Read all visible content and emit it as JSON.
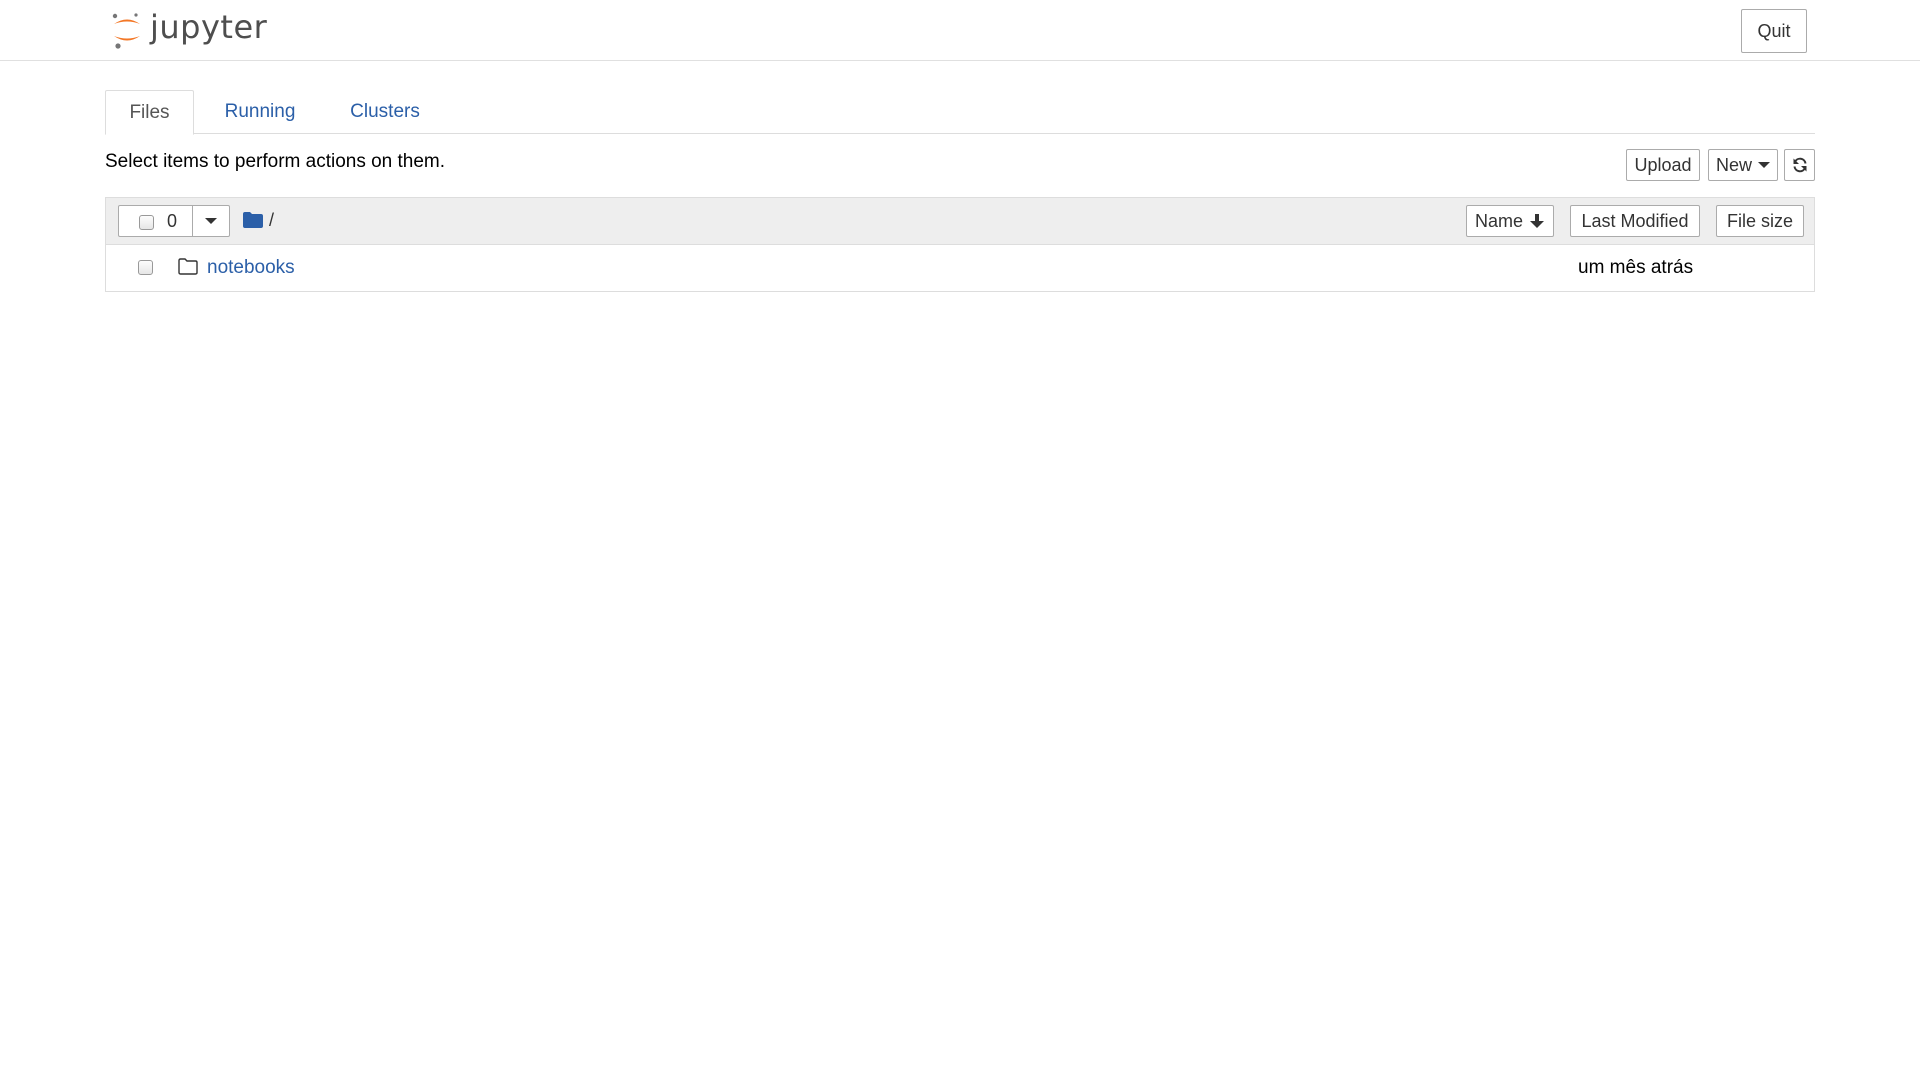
{
  "header": {
    "logo_text": "jupyter",
    "quit_label": "Quit"
  },
  "tabs": [
    {
      "label": "Files",
      "active": true
    },
    {
      "label": "Running",
      "active": false
    },
    {
      "label": "Clusters",
      "active": false
    }
  ],
  "toolbar": {
    "instructions": "Select items to perform actions on them.",
    "upload_label": "Upload",
    "new_label": "New"
  },
  "list_header": {
    "selected_count": "0",
    "breadcrumb": "/",
    "sort_name_label": "Name",
    "sort_last_modified_label": "Last Modified",
    "sort_file_size_label": "File size"
  },
  "items": [
    {
      "name": "notebooks",
      "type": "folder",
      "last_modified": "um mês atrás"
    }
  ],
  "colors": {
    "link": "#2b5fa8",
    "logo_orange": "#f37726",
    "logo_gray": "#767677",
    "folder_blue": "#2b5fa8"
  },
  "icons": {
    "refresh": "refresh-icon",
    "folder_open": "folder-icon",
    "folder_outline": "folder-outline-icon",
    "sort_arrow": "arrow-down-icon"
  }
}
